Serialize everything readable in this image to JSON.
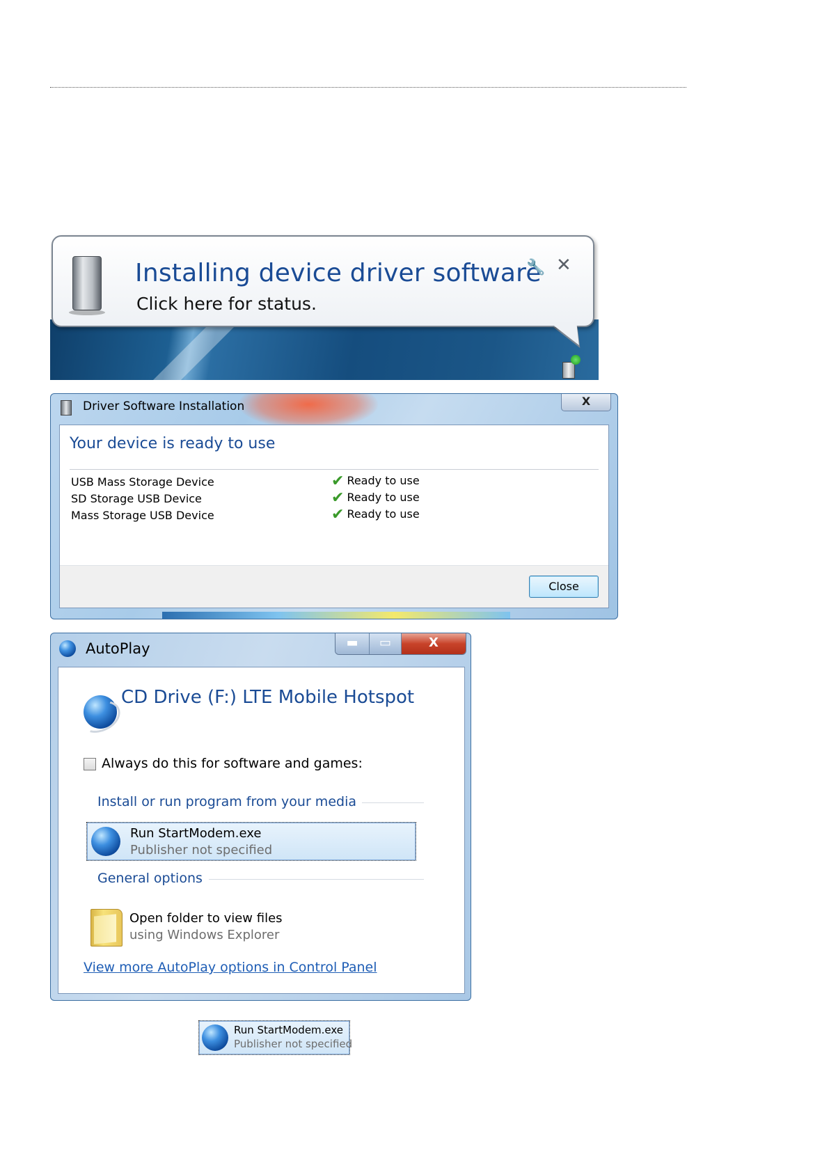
{
  "balloon": {
    "title": "Installing device driver software",
    "subtitle": "Click here for status.",
    "close_glyph": "✕",
    "wrench_glyph": "🔧"
  },
  "driver_dialog": {
    "title": "Driver Software Installation",
    "close_glyph": "X",
    "heading": "Your device is ready to use",
    "devices": [
      {
        "name": "USB Mass Storage Device",
        "status": "Ready to use"
      },
      {
        "name": "SD Storage USB Device",
        "status": "Ready to use"
      },
      {
        "name": "Mass Storage USB Device",
        "status": "Ready to use"
      }
    ],
    "close_button": "Close"
  },
  "autoplay": {
    "title": "AutoPlay",
    "min_glyph": "▬",
    "max_glyph": "▭",
    "close_glyph": "X",
    "heading": "CD Drive (F:) LTE Mobile Hotspot",
    "checkbox_label": "Always do this for software and games:",
    "group_install": "Install or run program from your media",
    "run_title": "Run StartModem.exe",
    "run_sub": "Publisher not specified",
    "group_general": "General options",
    "folder_title": "Open folder to view files",
    "folder_sub": "using Windows Explorer",
    "link": "View more AutoPlay options in Control Panel"
  },
  "mini_option": {
    "title": "Run StartModem.exe",
    "sub": "Publisher not specified"
  },
  "colors": {
    "heading_blue": "#1a4b95",
    "link_blue": "#1e5db5",
    "check_green": "#3a9a2a"
  },
  "icons": [
    "drive-icon",
    "wrench-icon",
    "close-icon",
    "check-icon",
    "globe-icon",
    "folder-icon"
  ]
}
